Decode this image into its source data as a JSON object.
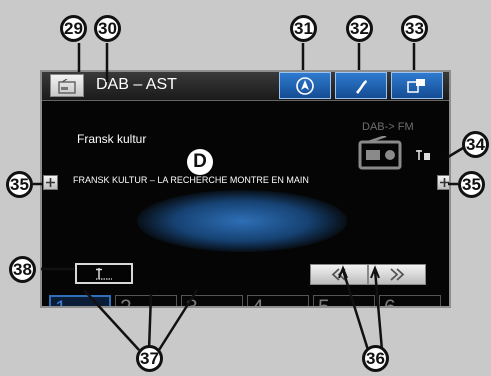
{
  "header": {
    "title": "DAB – AST"
  },
  "station": {
    "name": "Fransk kultur"
  },
  "radiotext": {
    "text": "FRANSK KULTUR – LA RECHERCHE MONTRE EN MAIN"
  },
  "dab_fm": {
    "label": "DAB-> FM"
  },
  "presets": [
    {
      "label": "1"
    },
    {
      "label": "2"
    },
    {
      "label": "3"
    },
    {
      "label": "4"
    },
    {
      "label": "5"
    },
    {
      "label": "6"
    }
  ],
  "callouts": {
    "c29": "29",
    "c30": "30",
    "c31": "31",
    "c32": "32",
    "c33": "33",
    "c34": "34",
    "c35_left": "35",
    "c35_right": "35",
    "c36": "36",
    "c37": "37",
    "c38": "38",
    "d": "D"
  },
  "icons": {
    "source": "radio-source-icon",
    "nav": "navigation-icon",
    "phone": "phone-icon",
    "media": "media-icon",
    "radio": "radio-icon",
    "signal": "signal-icon",
    "plus": "plus-icon",
    "list": "station-list-icon",
    "prev": "seek-back-icon",
    "next": "seek-forward-icon"
  },
  "colors": {
    "accent": "#2f6fb8",
    "tab": "#1a5aa8",
    "background": "#050505"
  }
}
